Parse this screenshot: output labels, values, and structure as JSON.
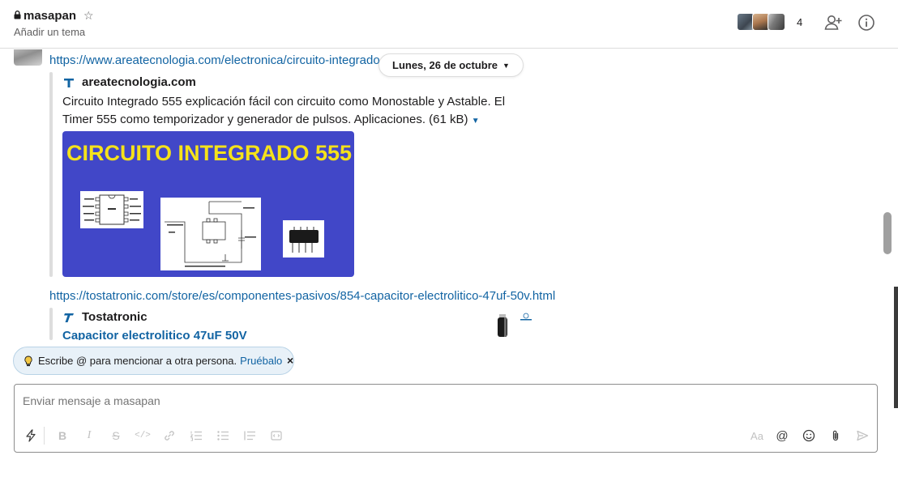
{
  "header": {
    "channel_name": "masapan",
    "topic": "Añadir un tema",
    "member_count": "4"
  },
  "messages": {
    "link1": "https://www.areatecnologia.com/electronica/circuito-integrado",
    "date_divider": "Lunes, 26 de octubre",
    "attachment1": {
      "site": "areatecnologia.com",
      "description": "Circuito Integrado 555 explicación fácil con circuito como Monostable y Astable. El Timer 555 como temporizador y generador de pulsos. Aplicaciones. (61 kB)",
      "preview_title": "CIRCUITO INTEGRADO 555"
    },
    "link2": "https://tostatronic.com/store/es/componentes-pasivos/854-capacitor-electrolitico-47uf-50v.html",
    "attachment2": {
      "site": "Tostatronic",
      "title": "Capacitor electrolitico 47uF 50V"
    }
  },
  "hint": {
    "text": "Escribe @ para mencionar a otra persona.",
    "action": "Pruébalo",
    "close": "×"
  },
  "composer": {
    "placeholder": "Enviar mensaje a masapan",
    "format_label": "Aa",
    "mention_label": "@"
  },
  "colors": {
    "link": "#1264a3",
    "preview_bg": "#4147c8",
    "preview_title": "#f5e21a",
    "hint_bg": "#e8f1f8"
  },
  "icons": [
    "lock-icon",
    "star-icon",
    "add-member-icon",
    "info-icon",
    "chevron-down-icon",
    "bulb-icon",
    "shortcuts-icon",
    "bold-icon",
    "italic-icon",
    "strike-icon",
    "code-icon",
    "link-icon",
    "ordered-list-icon",
    "bullet-list-icon",
    "blockquote-icon",
    "code-block-icon",
    "emoji-icon",
    "attach-icon",
    "send-icon"
  ]
}
